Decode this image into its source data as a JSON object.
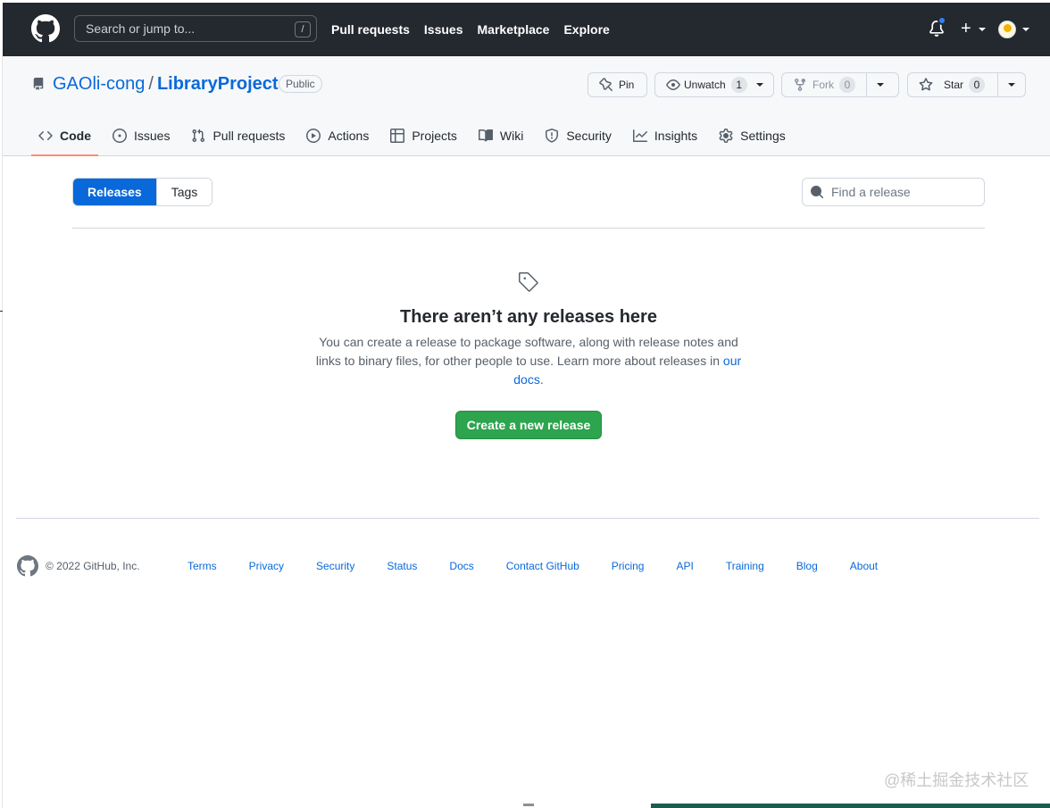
{
  "header": {
    "search_placeholder": "Search or jump to...",
    "slash_key": "/",
    "nav": [
      "Pull requests",
      "Issues",
      "Marketplace",
      "Explore"
    ],
    "plus_label": "+"
  },
  "repo": {
    "owner": "GAOli-cong",
    "separator": "/",
    "name": "LibraryProject",
    "visibility": "Public",
    "pin_label": "Pin",
    "unwatch_label": "Unwatch",
    "watch_count": "1",
    "fork_label": "Fork",
    "fork_count": "0",
    "star_label": "Star",
    "star_count": "0"
  },
  "tabs": [
    {
      "label": "Code",
      "icon": "code-icon",
      "active": true
    },
    {
      "label": "Issues",
      "icon": "issue-opened-icon"
    },
    {
      "label": "Pull requests",
      "icon": "git-pull-request-icon"
    },
    {
      "label": "Actions",
      "icon": "play-icon"
    },
    {
      "label": "Projects",
      "icon": "table-icon"
    },
    {
      "label": "Wiki",
      "icon": "book-icon"
    },
    {
      "label": "Security",
      "icon": "shield-icon"
    },
    {
      "label": "Insights",
      "icon": "graph-icon"
    },
    {
      "label": "Settings",
      "icon": "gear-icon"
    }
  ],
  "releases": {
    "toggle": [
      "Releases",
      "Tags"
    ],
    "find_placeholder": "Find a release",
    "empty_title": "There aren’t any releases here",
    "empty_text": "You can create a release to package software, along with release notes and links to binary files, for other people to use. Learn more about releases in ",
    "docs_link": "our docs",
    "empty_text_end": ".",
    "create_button": "Create a new release"
  },
  "footer": {
    "copyright": "© 2022 GitHub, Inc.",
    "links": [
      "Terms",
      "Privacy",
      "Security",
      "Status",
      "Docs",
      "Contact GitHub",
      "Pricing",
      "API",
      "Training",
      "Blog",
      "About"
    ]
  },
  "watermark": "@稀土掘金技术社区",
  "colors": {
    "header_bg": "#24292f",
    "link": "#0969da",
    "primary_green": "#2da44e",
    "active_tab_underline": "#fd8c73"
  }
}
